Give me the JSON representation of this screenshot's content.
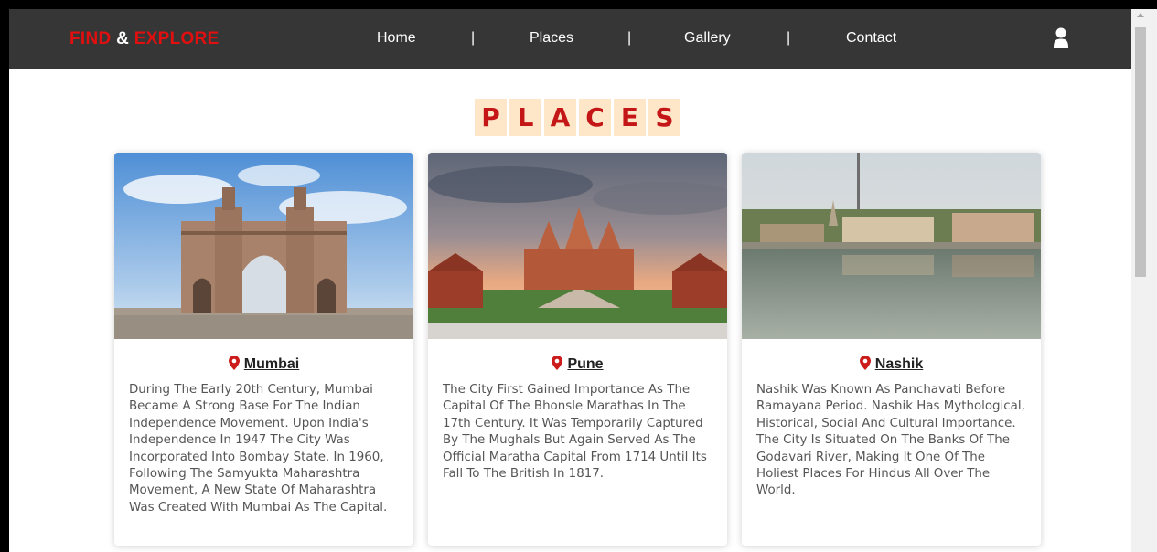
{
  "navbar": {
    "brand": {
      "part1": "FIND",
      "part2": " & ",
      "part3": "EXPLORE"
    },
    "items": [
      {
        "label": "Home"
      },
      {
        "label": "Places"
      },
      {
        "label": "Gallery"
      },
      {
        "label": "Contact"
      }
    ],
    "separator": "|",
    "user_icon": "user-icon"
  },
  "heading": {
    "letters": [
      "P",
      "L",
      "A",
      "C",
      "E",
      "S"
    ]
  },
  "cards": [
    {
      "name": "Mumbai",
      "image": "gateway-of-india-photo",
      "description": "During The Early 20th Century, Mumbai Became A Strong Base For The Indian Independence Movement. Upon India's Independence In 1947 The City Was Incorporated Into Bombay State. In 1960, Following The Samyukta Maharashtra Movement, A New State Of Maharashtra Was Created With Mumbai As The Capital."
    },
    {
      "name": "Pune",
      "image": "temple-photo",
      "description": "The City First Gained Importance As The Capital Of The Bhonsle Marathas In The 17th Century. It Was Temporarily Captured By The Mughals But Again Served As The Official Maratha Capital From 1714 Until Its Fall To The British In 1817."
    },
    {
      "name": "Nashik",
      "image": "godavari-river-photo",
      "description": "Nashik Was Known As Panchavati Before Ramayana Period. Nashik Has Mythological, Historical, Social And Cultural Importance. The City Is Situated On The Banks Of The Godavari River, Making It One Of The Holiest Places For Hindus All Over The World."
    }
  ],
  "colors": {
    "navbar": "#363636",
    "brand_red": "#e10f0f",
    "heading_bg": "#fde7c8",
    "heading_text": "#c41616",
    "pin": "#cc1b1b"
  }
}
